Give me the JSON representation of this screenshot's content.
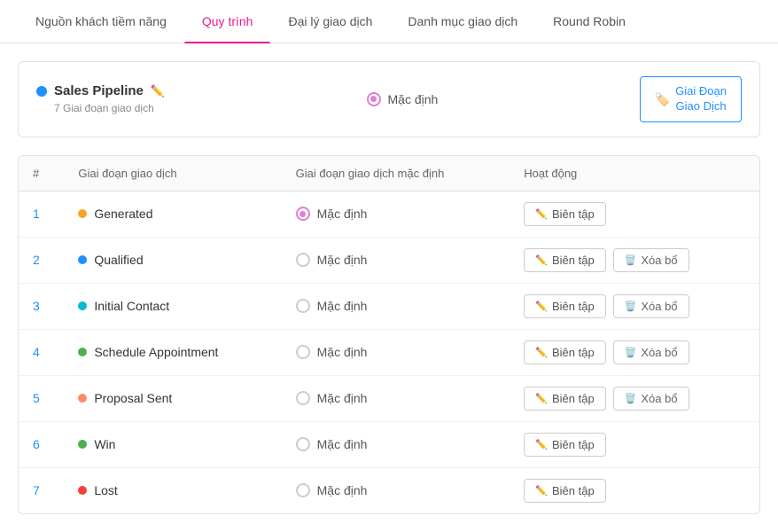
{
  "nav": {
    "tabs": [
      {
        "id": "nguon",
        "label": "Nguồn khách tiềm năng",
        "active": false
      },
      {
        "id": "quy-trinh",
        "label": "Quy trình",
        "active": true
      },
      {
        "id": "dai-ly",
        "label": "Đại lý giao dịch",
        "active": false
      },
      {
        "id": "danh-muc",
        "label": "Danh mục giao dịch",
        "active": false
      },
      {
        "id": "round-robin",
        "label": "Round Robin",
        "active": false
      }
    ]
  },
  "pipeline": {
    "dot_color": "#1e90ff",
    "title": "Sales Pipeline",
    "subtitle": "7 Giai đoạn giao dịch",
    "default_label": "Mặc định",
    "btn_label_line1": "Giai Đoạn",
    "btn_label_line2": "Giao Dịch"
  },
  "table": {
    "columns": [
      "#",
      "Giai đoạn giao dịch",
      "Giai đoạn giao dịch mặc định",
      "Hoạt động"
    ],
    "rows": [
      {
        "num": "1",
        "stage": "Generated",
        "dot_color": "#f5a623",
        "is_default": true,
        "show_delete": false
      },
      {
        "num": "2",
        "stage": "Qualified",
        "dot_color": "#1e90ff",
        "is_default": false,
        "show_delete": true
      },
      {
        "num": "3",
        "stage": "Initial Contact",
        "dot_color": "#00bcd4",
        "is_default": false,
        "show_delete": true
      },
      {
        "num": "4",
        "stage": "Schedule Appointment",
        "dot_color": "#4caf50",
        "is_default": false,
        "show_delete": true
      },
      {
        "num": "5",
        "stage": "Proposal Sent",
        "dot_color": "#ff8a65",
        "is_default": false,
        "show_delete": true
      },
      {
        "num": "6",
        "stage": "Win",
        "dot_color": "#4caf50",
        "is_default": false,
        "show_delete": false
      },
      {
        "num": "7",
        "stage": "Lost",
        "dot_color": "#f44336",
        "is_default": false,
        "show_delete": false
      }
    ],
    "edit_label": "Biên tập",
    "delete_label": "Xóa bổ",
    "default_radio_label": "Mặc định"
  }
}
